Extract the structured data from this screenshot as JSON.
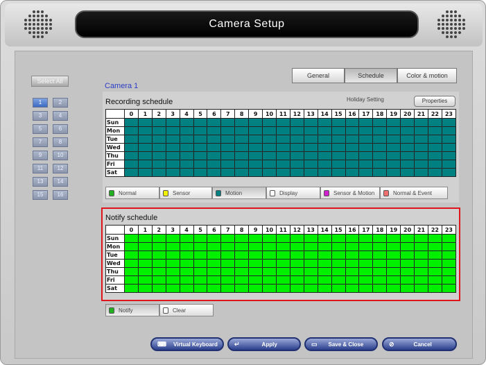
{
  "window": {
    "title": "Camera Setup"
  },
  "left_panel": {
    "select_all": "Select All",
    "cameras": [
      "1",
      "2",
      "3",
      "4",
      "5",
      "6",
      "7",
      "8",
      "9",
      "10",
      "11",
      "12",
      "13",
      "14",
      "15",
      "16"
    ],
    "active_camera": "1"
  },
  "header": {
    "camera_label": "Camera 1"
  },
  "tabs": [
    {
      "label": "General",
      "selected": false
    },
    {
      "label": "Schedule",
      "selected": true
    },
    {
      "label": "Color & motion",
      "selected": false
    }
  ],
  "recording": {
    "title": "Recording schedule",
    "holiday": "Holiday Setting",
    "properties_btn": "Properties",
    "cell_color": "#008080"
  },
  "hours": [
    "0",
    "1",
    "2",
    "3",
    "4",
    "5",
    "6",
    "7",
    "8",
    "9",
    "10",
    "11",
    "12",
    "13",
    "14",
    "15",
    "16",
    "17",
    "18",
    "19",
    "20",
    "21",
    "22",
    "23"
  ],
  "days": [
    "Sun",
    "Mon",
    "Tue",
    "Wed",
    "Thu",
    "Fri",
    "Sat"
  ],
  "legend_recording": [
    {
      "label": "Normal",
      "color": "#22b022"
    },
    {
      "label": "Sensor",
      "color": "#f2f200"
    },
    {
      "label": "Motion",
      "color": "#008080",
      "selected": true
    },
    {
      "label": "Display",
      "color": "#ffffff"
    },
    {
      "label": "Sensor & Motion",
      "color": "#d020d0"
    },
    {
      "label": "Normal & Event",
      "color": "#f07070"
    }
  ],
  "notify": {
    "title": "Notify schedule",
    "cell_color": "#00f000"
  },
  "legend_notify": [
    {
      "label": "Notify",
      "color": "#22b022",
      "selected": true
    },
    {
      "label": "Clear",
      "color": "#ffffff"
    }
  ],
  "buttons": {
    "virtual_keyboard": "Virtual Keyboard",
    "apply": "Apply",
    "save_close": "Save & Close",
    "cancel": "Cancel"
  }
}
